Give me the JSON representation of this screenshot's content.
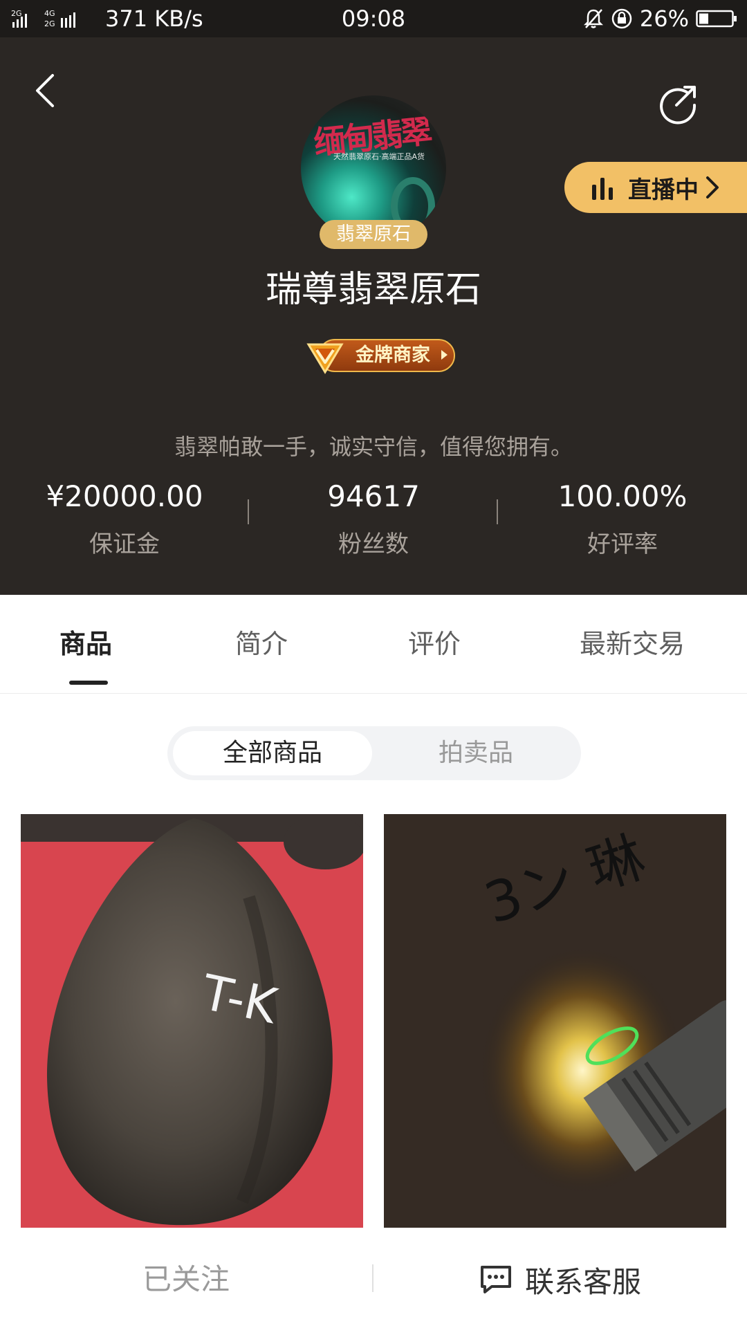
{
  "status_bar": {
    "net_speed": "371 KB/s",
    "time": "09:08",
    "battery": "26%",
    "signal_labels": [
      "2G",
      "4G",
      "2G"
    ]
  },
  "header": {
    "avatar_text": "缅甸翡翠",
    "avatar_subtext": "天然翡翠原石·高端正品A货",
    "category_badge": "翡翠原石",
    "live_label": "直播中",
    "shop_name": "瑞尊翡翠原石",
    "gold_badge": "金牌商家",
    "slogan": "翡翠帕敢一手，诚实守信，值得您拥有。",
    "stats": [
      {
        "value": "¥20000.00",
        "label": "保证金"
      },
      {
        "value": "94617",
        "label": "粉丝数"
      },
      {
        "value": "100.00%",
        "label": "好评率"
      }
    ]
  },
  "tabs": [
    {
      "label": "商品",
      "active": true
    },
    {
      "label": "简介",
      "active": false
    },
    {
      "label": "评价",
      "active": false
    },
    {
      "label": "最新交易",
      "active": false
    }
  ],
  "segments": [
    {
      "label": "全部商品",
      "active": true
    },
    {
      "label": "拍卖品",
      "active": false
    }
  ],
  "products": [
    {
      "image_text": "T-K"
    },
    {
      "image_text": "3ン 琳"
    }
  ],
  "bottom_bar": {
    "follow_label": "已关注",
    "service_label": "联系客服"
  },
  "colors": {
    "header_bg": "#2b2724",
    "live_pill": "#f2c066",
    "badge_gold": "#e0b96a"
  },
  "icons": [
    "back-icon",
    "share-icon",
    "live-bars-icon",
    "chevron-right-icon",
    "chat-icon",
    "bell-mute-icon",
    "lock-rotation-icon",
    "battery-icon"
  ]
}
